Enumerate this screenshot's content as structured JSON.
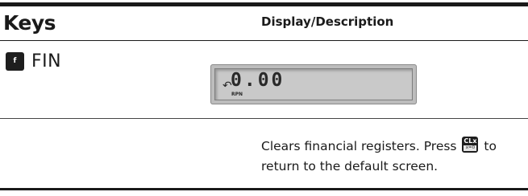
{
  "header": {
    "keys": "Keys",
    "description": "Display/Description"
  },
  "row": {
    "key_label": "f",
    "key_name": "FIN",
    "display": {
      "arrow": "↶",
      "value": "0.00",
      "mode": "RPN"
    },
    "description": {
      "part1": "Clears financial registers. Press",
      "key_top": "CLx",
      "key_bottom": "x=0",
      "part2": "to return to the default screen."
    }
  }
}
